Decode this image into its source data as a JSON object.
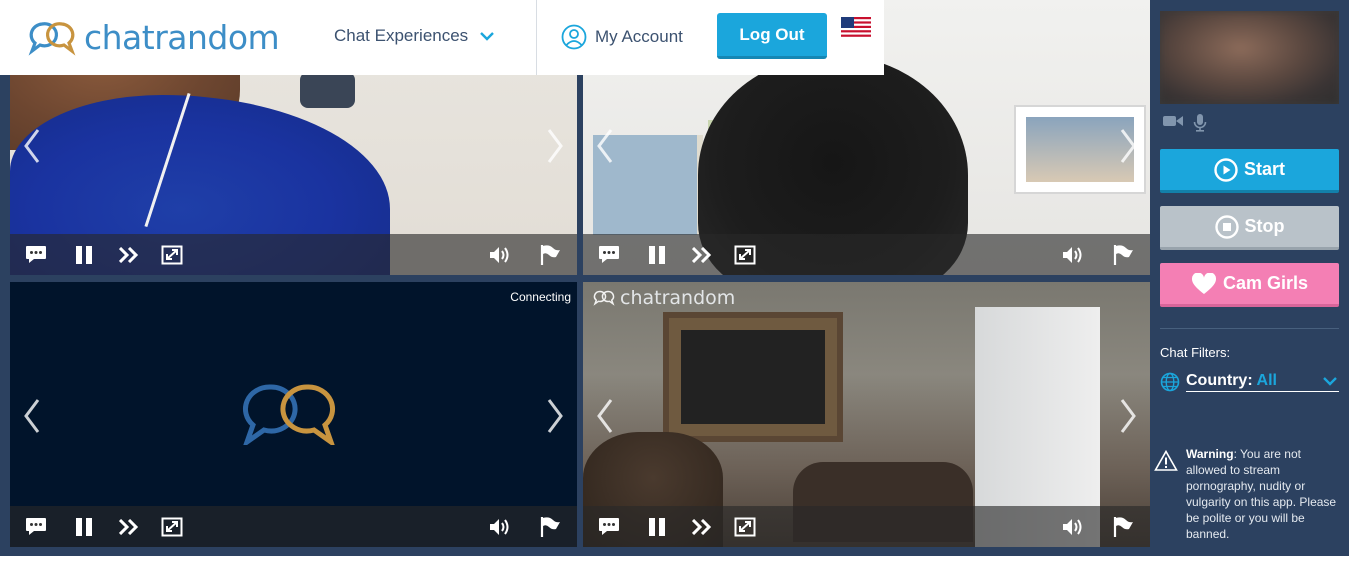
{
  "header": {
    "brand": "chatrandom",
    "nav_experiences": "Chat Experiences",
    "my_account": "My Account",
    "logout": "Log Out",
    "flag_icon": "us-flag-icon"
  },
  "tiles": [
    {
      "id": "tile-1",
      "status": ""
    },
    {
      "id": "tile-2",
      "status": ""
    },
    {
      "id": "tile-3",
      "status": "Connecting"
    },
    {
      "id": "tile-4",
      "status": "",
      "watermark": "chatrandom"
    }
  ],
  "tile_controls": [
    "chat-icon",
    "pause-icon",
    "skip-icon",
    "expand-icon",
    "volume-icon",
    "report-flag-icon"
  ],
  "sidebar": {
    "start": "Start",
    "stop": "Stop",
    "cam_girls": "Cam Girls",
    "filters_label": "Chat Filters:",
    "country_label": "Country:",
    "country_value": "All",
    "warning_title": "Warning",
    "warning_text": ": You are not allowed to stream pornography, nudity or vulgarity on this app. Please be polite or you will be banned."
  },
  "colors": {
    "background": "#2c4160",
    "accent_blue": "#1ba6dc",
    "stop_gray": "#b9c2c9",
    "cam_pink": "#f47fb4",
    "brand_blue": "#3d8ec7",
    "brand_gold": "#c8943f"
  }
}
